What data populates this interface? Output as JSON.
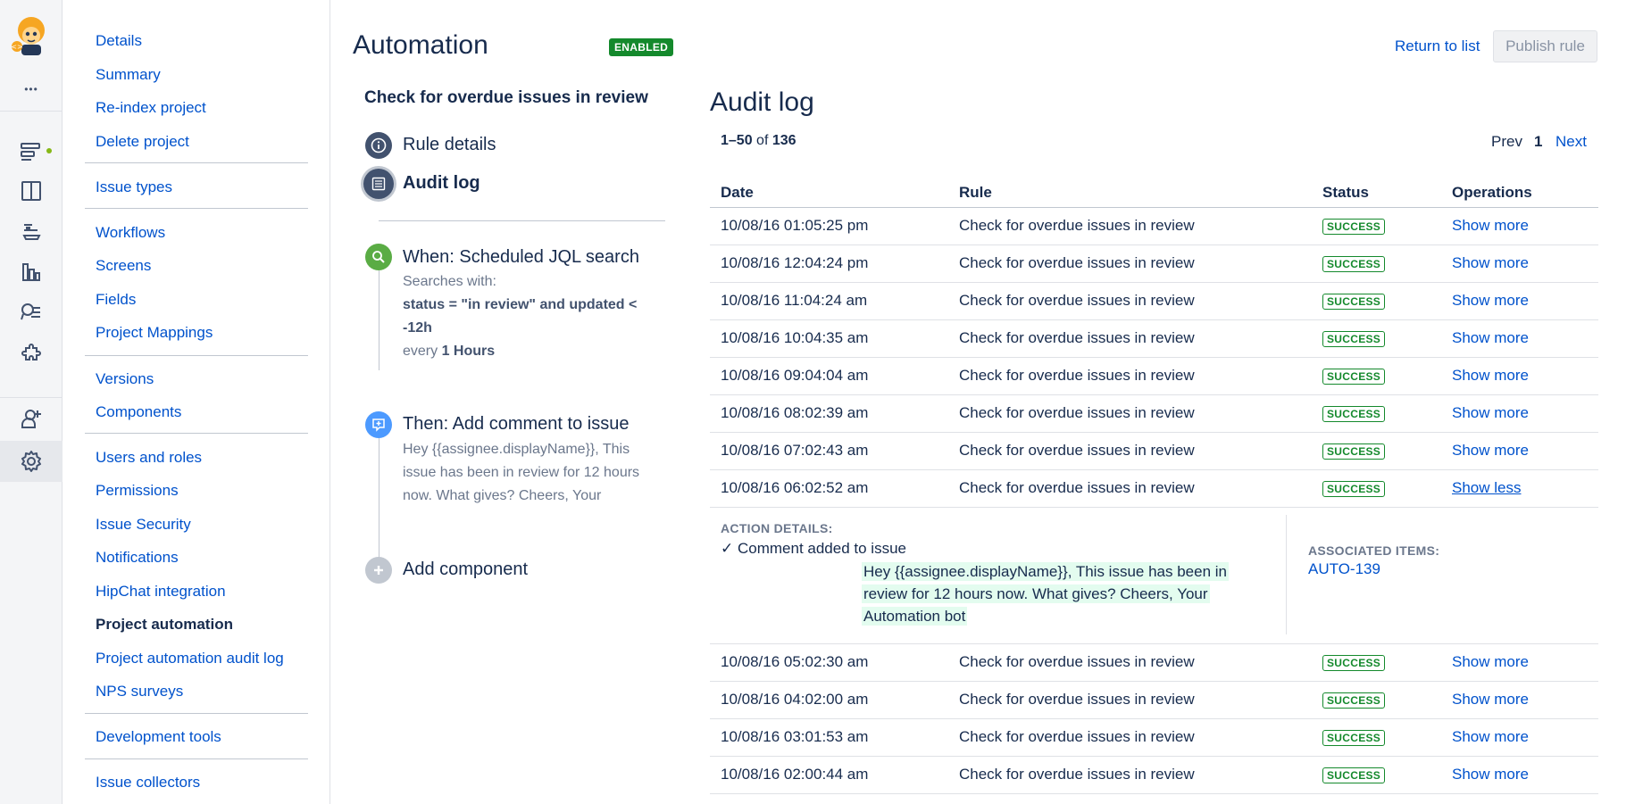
{
  "rail": {
    "icons": [
      "assistant-logo-icon",
      "more-icon",
      "backlog-icon",
      "board-icon",
      "releases-icon",
      "reports-icon",
      "issues-search-icon",
      "addons-icon",
      "add-user-icon",
      "settings-icon"
    ],
    "more_glyph": "•••"
  },
  "nav": {
    "items": [
      {
        "label": "Details"
      },
      {
        "label": "Summary"
      },
      {
        "label": "Re-index project"
      },
      {
        "label": "Delete project"
      },
      {
        "label": "Issue types"
      },
      {
        "label": "Workflows"
      },
      {
        "label": "Screens"
      },
      {
        "label": "Fields"
      },
      {
        "label": "Project Mappings"
      },
      {
        "label": "Versions"
      },
      {
        "label": "Components"
      },
      {
        "label": "Users and roles"
      },
      {
        "label": "Permissions"
      },
      {
        "label": "Issue Security"
      },
      {
        "label": "Notifications"
      },
      {
        "label": "HipChat integration"
      },
      {
        "label": "Project automation"
      },
      {
        "label": "Project automation audit log"
      },
      {
        "label": "NPS surveys"
      },
      {
        "label": "Development tools"
      },
      {
        "label": "Issue collectors"
      }
    ],
    "current": "Project automation"
  },
  "header": {
    "title": "Automation",
    "status_badge": "ENABLED",
    "return_link": "Return to list",
    "publish_button": "Publish rule"
  },
  "rule": {
    "name": "Check for overdue issues in review",
    "steps": {
      "rule_details": "Rule details",
      "audit_log": "Audit log",
      "trigger_title": "When: Scheduled JQL search",
      "trigger_line1": "Searches with:",
      "trigger_jql_1": "status = \"in review\" and updated <",
      "trigger_jql_2": "-12h",
      "trigger_every": "every",
      "trigger_interval": "1 Hours",
      "action_title": "Then: Add comment to issue",
      "action_line1": "Hey {{assignee.displayName}}, This",
      "action_line2": "issue has been in review for 12 hours",
      "action_line3": "now. What gives? Cheers, Your",
      "add_component": "Add component"
    }
  },
  "audit": {
    "title": "Audit log",
    "range": "1–50",
    "of_word": "of",
    "total": "136",
    "prev": "Prev",
    "page": "1",
    "next": "Next",
    "columns": {
      "date": "Date",
      "rule": "Rule",
      "status": "Status",
      "operations": "Operations"
    },
    "rows_top": [
      {
        "date": "10/08/16 01:05:25 pm",
        "rule": "Check for overdue issues in review",
        "status": "SUCCESS",
        "op": "Show more"
      },
      {
        "date": "10/08/16 12:04:24 pm",
        "rule": "Check for overdue issues in review",
        "status": "SUCCESS",
        "op": "Show more"
      },
      {
        "date": "10/08/16 11:04:24 am",
        "rule": "Check for overdue issues in review",
        "status": "SUCCESS",
        "op": "Show more"
      },
      {
        "date": "10/08/16 10:04:35 am",
        "rule": "Check for overdue issues in review",
        "status": "SUCCESS",
        "op": "Show more"
      },
      {
        "date": "10/08/16 09:04:04 am",
        "rule": "Check for overdue issues in review",
        "status": "SUCCESS",
        "op": "Show more"
      },
      {
        "date": "10/08/16 08:02:39 am",
        "rule": "Check for overdue issues in review",
        "status": "SUCCESS",
        "op": "Show more"
      },
      {
        "date": "10/08/16 07:02:43 am",
        "rule": "Check for overdue issues in review",
        "status": "SUCCESS",
        "op": "Show more"
      },
      {
        "date": "10/08/16 06:02:52 am",
        "rule": "Check for overdue issues in review",
        "status": "SUCCESS",
        "op": "Show less"
      }
    ],
    "details": {
      "action_label": "ACTION DETAILS:",
      "check_glyph": "✓",
      "action_text": "Comment added to issue",
      "comment": "Hey {{assignee.displayName}}, This issue has been in review for 12 hours now. What gives? Cheers, Your Automation bot",
      "associated_label": "ASSOCIATED ITEMS:",
      "associated_item": "AUTO-139"
    },
    "rows_bottom": [
      {
        "date": "10/08/16 05:02:30 am",
        "rule": "Check for overdue issues in review",
        "status": "SUCCESS",
        "op": "Show more"
      },
      {
        "date": "10/08/16 04:02:00 am",
        "rule": "Check for overdue issues in review",
        "status": "SUCCESS",
        "op": "Show more"
      },
      {
        "date": "10/08/16 03:01:53 am",
        "rule": "Check for overdue issues in review",
        "status": "SUCCESS",
        "op": "Show more"
      },
      {
        "date": "10/08/16 02:00:44 am",
        "rule": "Check for overdue issues in review",
        "status": "SUCCESS",
        "op": "Show more"
      }
    ]
  },
  "colors": {
    "link": "#0052cc",
    "success": "#14892c",
    "step_dark": "#42526e",
    "step_green": "#5aac44",
    "step_blue": "#4c9aff",
    "step_grey": "#c1c7d0",
    "highlight": "#e3fcef"
  }
}
